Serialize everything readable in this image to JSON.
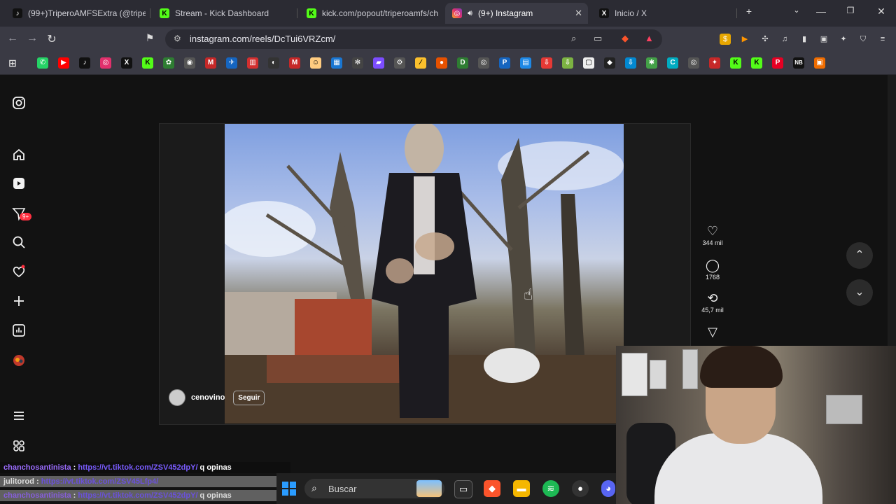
{
  "browser": {
    "tabs": [
      {
        "title": "(99+)TriperoAMFSExtra (@tripero",
        "icon": "tiktok-icon",
        "fav": "♪",
        "favColor": "#000000"
      },
      {
        "title": "Stream - Kick Dashboard",
        "icon": "kick-icon",
        "fav": "K",
        "favColor": "#53fc18"
      },
      {
        "title": "kick.com/popout/triperoamfs/ch",
        "icon": "kick-icon",
        "fav": "K",
        "favColor": "#53fc18"
      },
      {
        "title": "(9+) Instagram",
        "icon": "instagram-icon",
        "fav": "◎",
        "favColor": "#e1306c",
        "active": true
      },
      {
        "title": "Inicio / X",
        "icon": "x-icon",
        "fav": "X",
        "favColor": "#000000"
      }
    ],
    "new_tab": "+",
    "address": "instagram.com/reels/DcTui6VRZcm/"
  },
  "instagram": {
    "sidebar": [
      "instagram-logo-icon",
      "home-icon",
      "reels-icon",
      "messages-icon",
      "search-icon",
      "notifications-icon",
      "create-icon",
      "dashboard-icon",
      "profile-icon",
      "menu-icon",
      "meta-icon"
    ],
    "messages_badge": "9+",
    "reel": {
      "author": "cenovino",
      "follow_label": "Seguir",
      "likes": "344 mil",
      "comments": "1768",
      "reposts": "45,7 mil"
    }
  },
  "chat": [
    {
      "user": "chanchosantinista",
      "sep": " : ",
      "link": "https://vt.tiktok.com/ZSV452dpY/",
      "text": " q opinas"
    },
    {
      "user": "julitorod",
      "sep": " : ",
      "link": "https://vt.tiktok.com/ZSV45Lfp4/",
      "text": ""
    },
    {
      "user": "chanchosantinista",
      "sep": " : ",
      "link": "https://vt.tiktok.com/ZSV452dpY/",
      "text": " q opinas"
    }
  ],
  "taskbar": {
    "search_placeholder": "Buscar"
  },
  "colors": {
    "accent": "#ff3040",
    "kick": "#53fc18",
    "chat_user": "#9b6cff"
  }
}
